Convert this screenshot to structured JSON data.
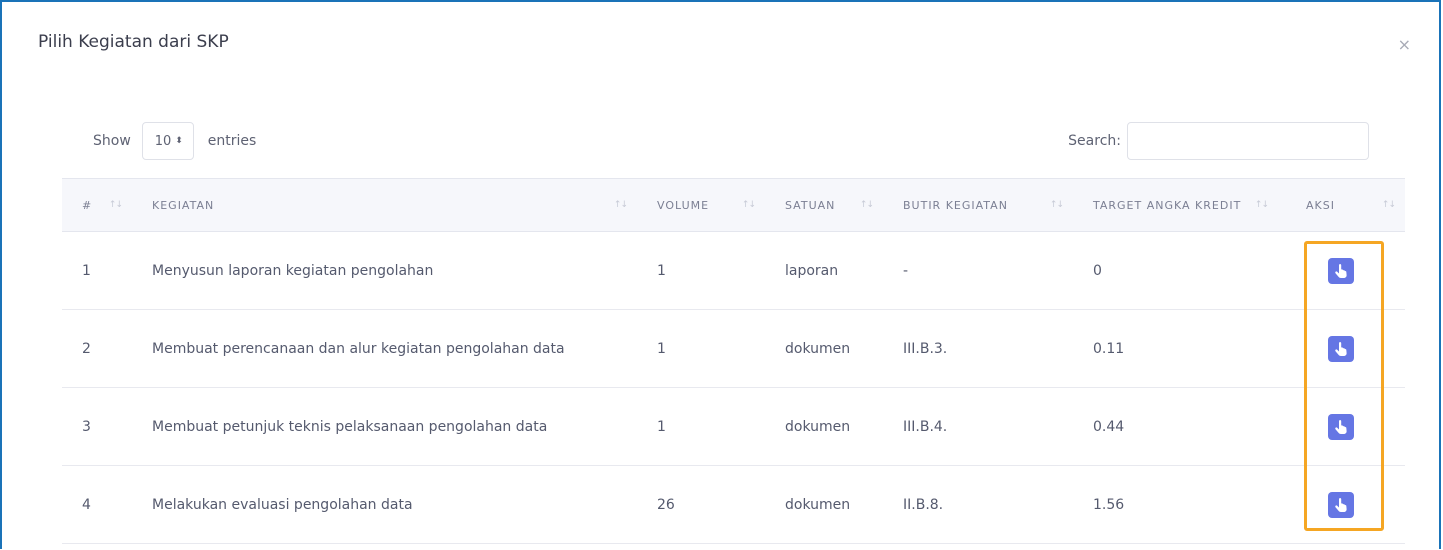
{
  "modal": {
    "title": "Pilih Kegiatan dari SKP",
    "close_label": "×"
  },
  "length": {
    "show_label": "Show",
    "value": "10",
    "arrows": "⬍",
    "entries_label": "entries"
  },
  "search": {
    "label": "Search:",
    "value": ""
  },
  "table": {
    "columns": [
      "#",
      "KEGIATAN",
      "VOLUME",
      "SATUAN",
      "BUTIR KEGIATAN",
      "TARGET ANGKA KREDIT",
      "AKSI"
    ],
    "sort_glyph": "↑↓",
    "rows": [
      {
        "no": "1",
        "kegiatan": "Menyusun laporan kegiatan pengolahan",
        "volume": "1",
        "satuan": "laporan",
        "butir": "-",
        "target": "0"
      },
      {
        "no": "2",
        "kegiatan": "Membuat perencanaan dan alur kegiatan pengolahan data",
        "volume": "1",
        "satuan": "dokumen",
        "butir": "III.B.3.",
        "target": "0.11"
      },
      {
        "no": "3",
        "kegiatan": "Membuat petunjuk teknis pelaksanaan pengolahan data",
        "volume": "1",
        "satuan": "dokumen",
        "butir": "III.B.4.",
        "target": "0.44"
      },
      {
        "no": "4",
        "kegiatan": "Melakukan evaluasi pengolahan data",
        "volume": "26",
        "satuan": "dokumen",
        "butir": "II.B.8.",
        "target": "1.56"
      }
    ],
    "action_icon": "hand-pointer-icon"
  },
  "colors": {
    "accent": "#6576e4",
    "highlight": "#f5a623",
    "modal_border": "#1a73b8"
  }
}
